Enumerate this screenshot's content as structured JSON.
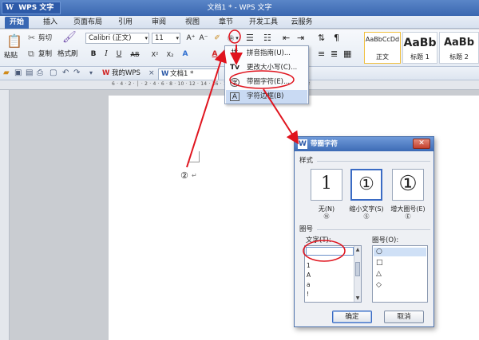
{
  "app": {
    "logo_mark": "W",
    "logo_label": "WPS 文字",
    "logo_caret": "▾",
    "window_title": "文档1 * - WPS 文字"
  },
  "menu": {
    "tabs": [
      "开始",
      "插入",
      "页面布局",
      "引用",
      "审阅",
      "视图",
      "章节",
      "开发工具",
      "云服务"
    ],
    "active_index": 0
  },
  "ribbon": {
    "clipboard": {
      "paste_label": "粘贴",
      "cut_label": "剪切",
      "copy_label": "复制",
      "format_painter_label": "格式刷"
    },
    "font": {
      "font_name": "Calibri (正文)",
      "font_size": "11",
      "grow_label": "A⁺",
      "shrink_label": "A⁻",
      "bold": "B",
      "italic": "I",
      "underline": "U",
      "strike": "AB",
      "superscript": "X²",
      "subscript": "X₂",
      "text_effect": "A",
      "font_color": "A"
    },
    "styles": [
      {
        "sample": "AaBbCcDd",
        "name": "正文"
      },
      {
        "sample": "AaBb",
        "name": "标题 1"
      },
      {
        "sample": "AaBb",
        "name": "标题 2"
      }
    ]
  },
  "quickbar": {
    "my_wps_label": "我的WPS",
    "doc_tab_label": "文档1 *",
    "close_glyph": "×"
  },
  "ruler": {
    "marks": "6 · 4 · 2 · │ · 2 · 4 · 6 · 8 · 10 · 12 · 14 · 16 · 18 · 20 · 22 · 24 · 26 · 28 · 30 · 32"
  },
  "document": {
    "circled_text": "②",
    "paragraph_mark": "↵"
  },
  "dropdown": {
    "items": [
      {
        "icon": "拼",
        "label": "拼音指南(U)..."
      },
      {
        "icon": "Tv",
        "label": "更改大小写(C)..."
      },
      {
        "icon": "字",
        "label": "带圈字符(E)..."
      },
      {
        "icon": "A",
        "label": "字符边框(B)"
      }
    ]
  },
  "dialog": {
    "title": "带圈字符",
    "title_icon": "W",
    "close_glyph": "✕",
    "style_group_label": "样式",
    "styles": [
      {
        "glyph": "1",
        "label": "无(N)",
        "key": "Ⓝ"
      },
      {
        "glyph": "①",
        "label": "缩小文字(S)",
        "key": "Ⓢ"
      },
      {
        "glyph": "①",
        "label": "增大圈号(E)",
        "key": "Ⓔ"
      }
    ],
    "selected_style_index": 1,
    "ring_group_label": "圈号",
    "text_label": "文字(T):",
    "ring_label": "圈号(O):",
    "text_list": [
      "1",
      "A",
      "a",
      "!"
    ],
    "ring_list": [
      "○",
      "□",
      "△",
      "◇"
    ],
    "selected_ring_index": 0,
    "ok_label": "确定",
    "cancel_label": "取消"
  },
  "colors": {
    "title_bar": "#3a67b0",
    "active_tab": "#3867b3",
    "annotation_red": "#e0141e",
    "dialog_border": "#4f74ad"
  }
}
